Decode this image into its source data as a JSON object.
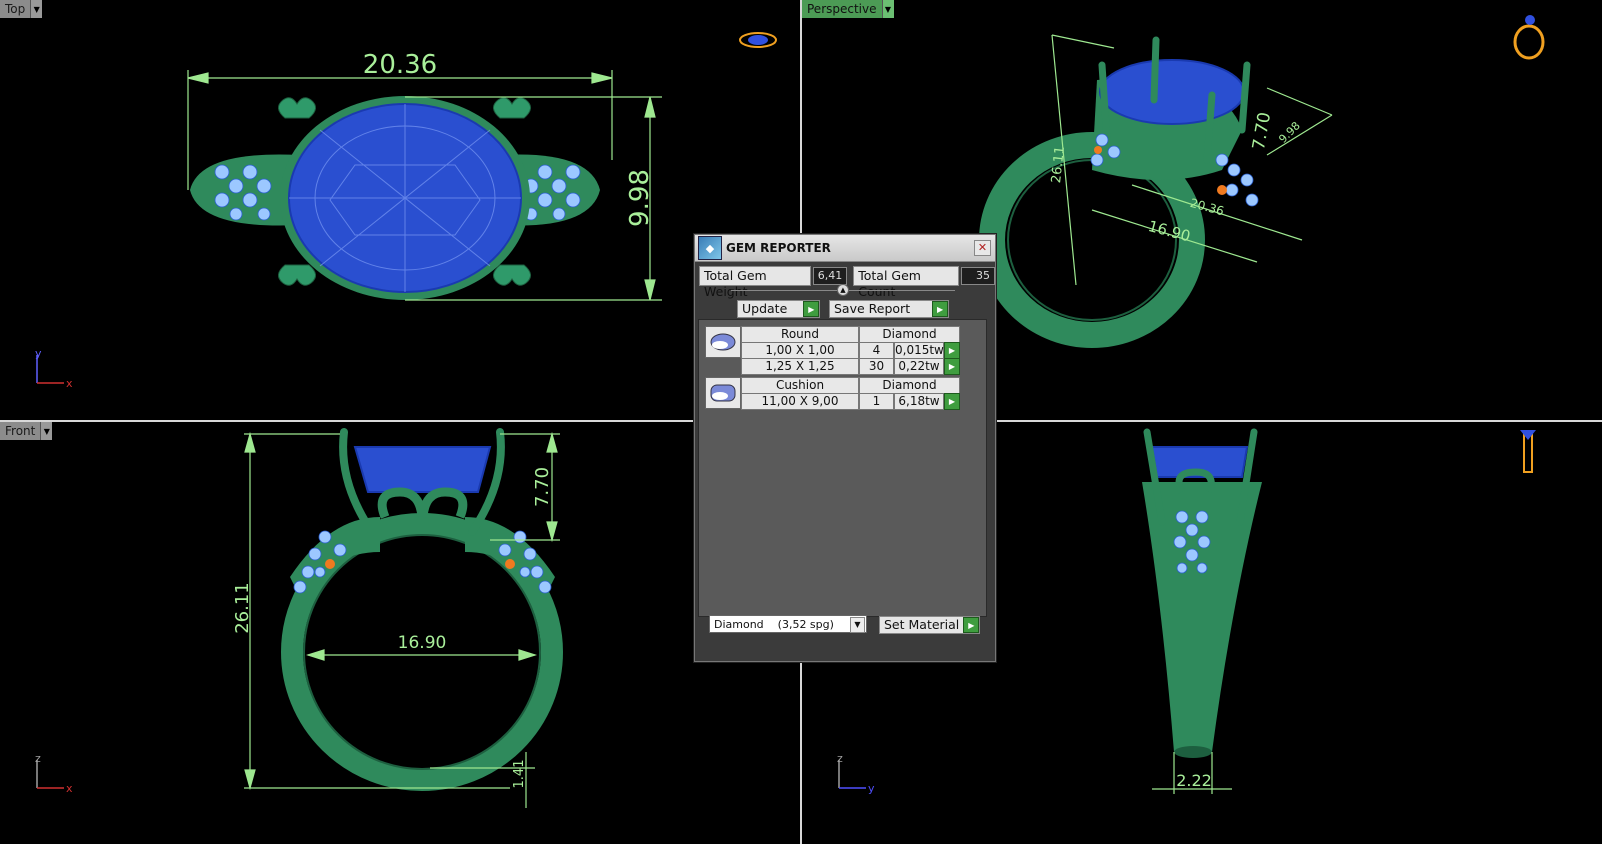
{
  "viewports": {
    "top": {
      "label": "Top",
      "axis_v": "y",
      "axis_h": "x"
    },
    "perspective": {
      "label": "Perspective"
    },
    "front": {
      "label": "Front",
      "axis_v": "z",
      "axis_h": "x"
    },
    "right": {
      "axis_v": "z",
      "axis_h": "y"
    }
  },
  "dimensions": {
    "top_width": "20.36",
    "top_height": "9.98",
    "persp_height": "26.11",
    "persp_setting": "7.70",
    "persp_setting2": "9.98",
    "persp_inner": "16.90",
    "persp_outer": "20.36",
    "front_height": "26.11",
    "front_setting": "7.70",
    "front_inner": "16.90",
    "front_shank": "1.41",
    "side_shank": "2.22"
  },
  "gem_reporter": {
    "title": "GEM REPORTER",
    "total_weight_label": "Total Gem Weight",
    "total_weight_value": "6,41",
    "total_count_label": "Total Gem Count",
    "total_count_value": "35",
    "update_label": "Update",
    "save_report_label": "Save Report",
    "groups": [
      {
        "shape": "Round",
        "material": "Diamond",
        "rows": [
          {
            "size": "1,00 X 1,00",
            "count": "4",
            "weight": "0,015tw"
          },
          {
            "size": "1,25 X 1,25",
            "count": "30",
            "weight": "0,22tw"
          }
        ]
      },
      {
        "shape": "Cushion",
        "material": "Diamond",
        "rows": [
          {
            "size": "11,00 X 9,00",
            "count": "1",
            "weight": "6,18tw"
          }
        ]
      }
    ],
    "material_select": "Diamond    (3,52 spg)",
    "set_material_label": "Set Material"
  },
  "colors": {
    "metal": "#2f8a5c",
    "gem": "#2a4fd0",
    "dimension": "#9ee890",
    "accent_gem": "#f07a20"
  }
}
